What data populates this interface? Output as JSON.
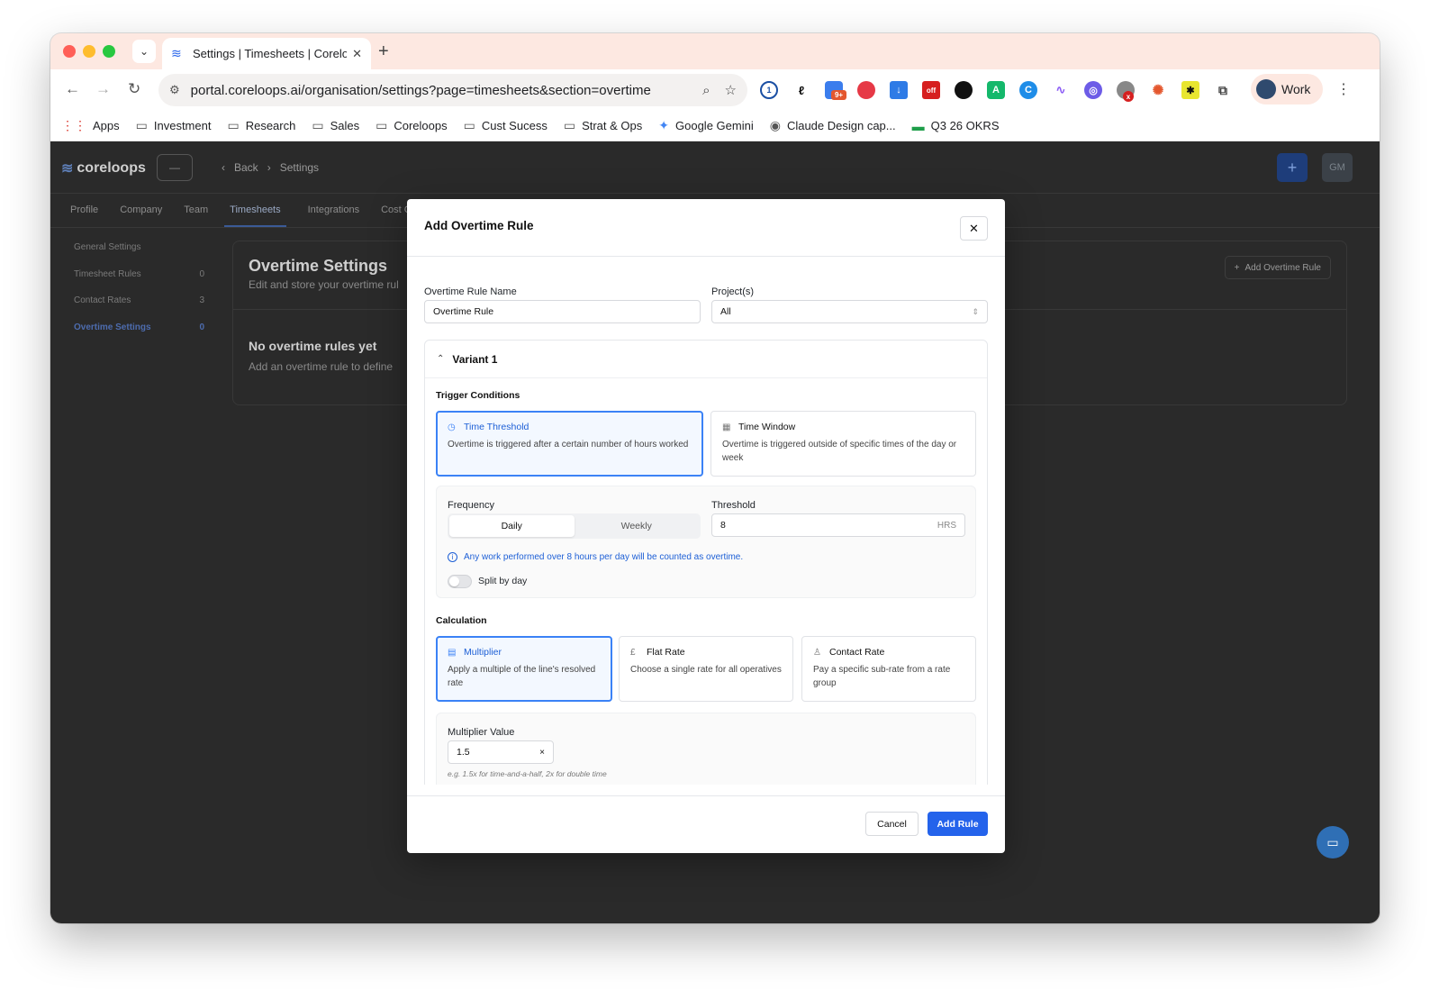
{
  "browser": {
    "tab_title": "Settings | Timesheets | Corelo",
    "url": "portal.coreloops.ai/organisation/settings?page=timesheets&section=overtime",
    "profile_label": "Work",
    "bookmarks": [
      "Apps",
      "Investment",
      "Research",
      "Sales",
      "Coreloops",
      "Cust Sucess",
      "Strat & Ops",
      "Google Gemini",
      "Claude Design cap...",
      "Q3 26 OKRS"
    ],
    "extension_badges": {
      "mail": "9+",
      "off": "off",
      "x": "x"
    }
  },
  "app": {
    "logo": "coreloops",
    "breadcrumb_back": "Back",
    "breadcrumb_current": "Settings",
    "avatar_initials": "GM",
    "tabs": [
      "Profile",
      "Company",
      "Team",
      "Timesheets",
      "Integrations",
      "Cost C"
    ],
    "sidenav": [
      {
        "label": "General Settings",
        "count": ""
      },
      {
        "label": "Timesheet Rules",
        "count": "0"
      },
      {
        "label": "Contact Rates",
        "count": "3"
      },
      {
        "label": "Overtime Settings",
        "count": "0"
      }
    ],
    "content_title": "Overtime Settings",
    "content_subtitle": "Edit and store your overtime rul",
    "add_overtime_button": "Add Overtime Rule",
    "empty_title": "No overtime rules yet",
    "empty_subtitle": "Add an overtime rule to define"
  },
  "modal": {
    "title": "Add Overtime Rule",
    "rule_name_label": "Overtime Rule Name",
    "rule_name_value": "Overtime Rule",
    "projects_label": "Project(s)",
    "projects_value": "All",
    "variant_title": "Variant 1",
    "trigger_title": "Trigger Conditions",
    "trigger_options": [
      {
        "title": "Time Threshold",
        "desc": "Overtime is triggered after a certain number of hours worked",
        "selected": true
      },
      {
        "title": "Time Window",
        "desc": "Overtime is triggered outside of specific times of the day or week",
        "selected": false
      }
    ],
    "frequency_label": "Frequency",
    "frequency_options": [
      "Daily",
      "Weekly"
    ],
    "threshold_label": "Threshold",
    "threshold_value": "8",
    "threshold_unit": "HRS",
    "info_text": "Any work performed over 8 hours per day will be counted as overtime.",
    "split_label": "Split by day",
    "calculation_title": "Calculation",
    "calc_options": [
      {
        "title": "Multiplier",
        "desc": "Apply a multiple of the line's resolved rate",
        "selected": true
      },
      {
        "title": "Flat Rate",
        "desc": "Choose a single rate for all operatives",
        "selected": false
      },
      {
        "title": "Contact Rate",
        "desc": "Pay a specific sub-rate from a rate group",
        "selected": false
      }
    ],
    "multiplier_label": "Multiplier Value",
    "multiplier_value": "1.5",
    "multiplier_hint": "e.g. 1.5x for time-and-a-half, 2x for double time",
    "cancel_label": "Cancel",
    "submit_label": "Add Rule"
  }
}
